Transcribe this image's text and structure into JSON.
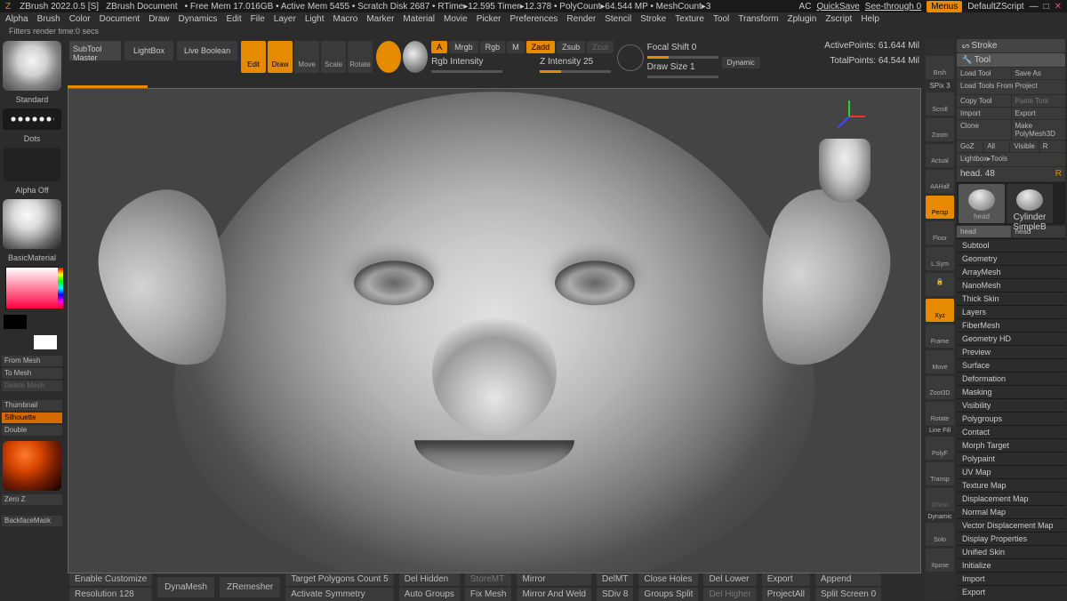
{
  "topbar": {
    "app": "ZBrush 2022.0.5 [S]",
    "doc": "ZBrush Document",
    "stats": "• Free Mem 17.016GB • Active Mem 5455 • Scratch Disk 2687 • RTime▸12.595 Timer▸12.378 • PolyCount▸64.544 MP • MeshCount▸3",
    "ac": "AC",
    "quicksave": "QuickSave",
    "seethrough": "See-through 0",
    "menus": "Menus",
    "script": "DefaultZScript"
  },
  "menu": [
    "Alpha",
    "Brush",
    "Color",
    "Document",
    "Draw",
    "Dynamics",
    "Edit",
    "File",
    "Layer",
    "Light",
    "Macro",
    "Marker",
    "Material",
    "Movie",
    "Picker",
    "Preferences",
    "Render",
    "Stencil",
    "Stroke",
    "Texture",
    "Tool",
    "Transform",
    "Zplugin",
    "Zscript",
    "Help"
  ],
  "filters": "Filters render time:0 secs",
  "left": {
    "subtool": "SubTool Master",
    "lightbox": "LightBox",
    "liveboolean": "Live Boolean",
    "standard": "Standard",
    "dots": "Dots",
    "alphaoff": "Alpha Off",
    "material": "BasicMaterial",
    "frommesh": "From Mesh",
    "tomesh": "To Mesh",
    "deletemesh": "Delete Mesh",
    "thumbnail": "Thumbnail",
    "silhouette": "Silhouette",
    "double": "Double",
    "zeroz": "Zero Z",
    "backface": "BackfaceMask"
  },
  "tools": {
    "edit": "Edit",
    "draw": "Draw",
    "move": "Move",
    "scale": "Scale",
    "rotate": "Rotate",
    "a": "A",
    "mrgb": "Mrgb",
    "rgb": "Rgb",
    "m": "M",
    "zadd": "Zadd",
    "zsub": "Zsub",
    "zcut": "Zcut",
    "rgbint": "Rgb Intensity",
    "zint": "Z Intensity 25",
    "focal": "Focal Shift 0",
    "drawsize": "Draw Size 1",
    "dynamic": "Dynamic",
    "active": "ActivePoints: 61.644 Mil",
    "total": "TotalPoints: 64.544 Mil"
  },
  "rail": {
    "spix": "SPix 3",
    "brsh": "Brsh",
    "scroll": "Scroll",
    "zoom": "Zoom",
    "actual": "Actual",
    "aahalf": "AAHalf",
    "persp": "Persp",
    "floor": "Floor",
    "lsym": "L.Sym",
    "lock": "",
    "xyz": "Xyz",
    "frame": "Frame",
    "move": "Move",
    "zook": "Zoot3D",
    "rotate": "Rotate",
    "linefill": "Line Fill",
    "polyf": "PolyF",
    "transp": "Transp",
    "ghost": "Ghost",
    "dynamic": "Dynamic",
    "solo": "Solo",
    "xpose": "Xpose"
  },
  "panel": {
    "stroke": "Stroke",
    "tool": "Tool",
    "loadtool": "Load Tool",
    "saveas": "Save As",
    "loadfrom": "Load Tools From Project",
    "copytool": "Copy Tool",
    "pastetool": "Paste Tool",
    "import": "Import",
    "export": "Export",
    "clone": "Clone",
    "makepm": "Make PolyMesh3D",
    "goz": "GoZ",
    "all": "All",
    "visible": "Visible",
    "r": "R",
    "lightboxtools": "Lightbox▸Tools",
    "head48": "head. 48",
    "thumbs": {
      "head": "head",
      "head2": "head",
      "cyl": "Cylinder",
      "simpleB": "SimpleB"
    },
    "accordions": [
      "Subtool",
      "Geometry",
      "ArrayMesh",
      "NanoMesh",
      "Thick Skin",
      "Layers",
      "FiberMesh",
      "Geometry HD",
      "Preview",
      "Surface",
      "Deformation",
      "Masking",
      "Visibility",
      "Polygroups",
      "Contact",
      "Morph Target",
      "Polypaint",
      "UV Map",
      "Texture Map",
      "Displacement Map",
      "Normal Map",
      "Vector Displacement Map",
      "Display Properties",
      "Unified Skin",
      "Initialize",
      "Import",
      "Export"
    ]
  },
  "bottom": {
    "enablecustom": "Enable Customize",
    "resolution": "Resolution 128",
    "dynamesh": "DynaMesh",
    "zremesher": "ZRemesher",
    "target": "Target Polygons Count 5",
    "actsym": "Activate Symmetry",
    "delhidden": "Del Hidden",
    "autogroups": "Auto Groups",
    "storemt": "StoreMT",
    "fixmesh": "Fix Mesh",
    "mirror": "Mirror",
    "mirrorweld": "Mirror And Weld",
    "delmt": "DelMT",
    "sdiv": "SDiv 8",
    "closeholes": "Close Holes",
    "groupssplit": "Groups Split",
    "dellower": "Del Lower",
    "delhigher": "Del Higher",
    "zexport": "Export",
    "projectall": "ProjectAll",
    "append": "Append",
    "splitscreen": "Split Screen 0"
  }
}
